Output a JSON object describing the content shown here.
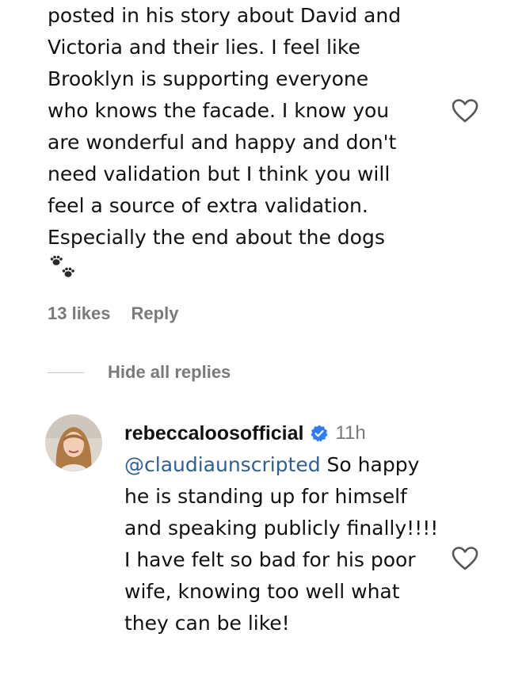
{
  "comment": {
    "text": "posted in his story about David and\nVictoria and their lies. I feel like\nBrooklyn is supporting everyone\nwho knows the facade. I know you\nare wonderful and happy and don't\nneed validation but I think you will\nfeel a source of extra validation.\nEspecially the end about the dogs",
    "emoji_icon": "paw-prints-icon",
    "likes": "13 likes",
    "reply_label": "Reply"
  },
  "thread": {
    "hide_label": "Hide all replies"
  },
  "reply": {
    "username": "rebeccaloosofficial",
    "time": "11h",
    "mention": "@claudiaunscripted",
    "text": " So happy he is standing up for himself and speaking publicly finally!!!! I have felt so bad for his poor wife, knowing too well what they can be like!"
  },
  "colors": {
    "text": "#111111",
    "meta_gray": "#7a7a7a",
    "mention_blue": "#2f5f95",
    "verified_blue": "#2f7cf6"
  }
}
